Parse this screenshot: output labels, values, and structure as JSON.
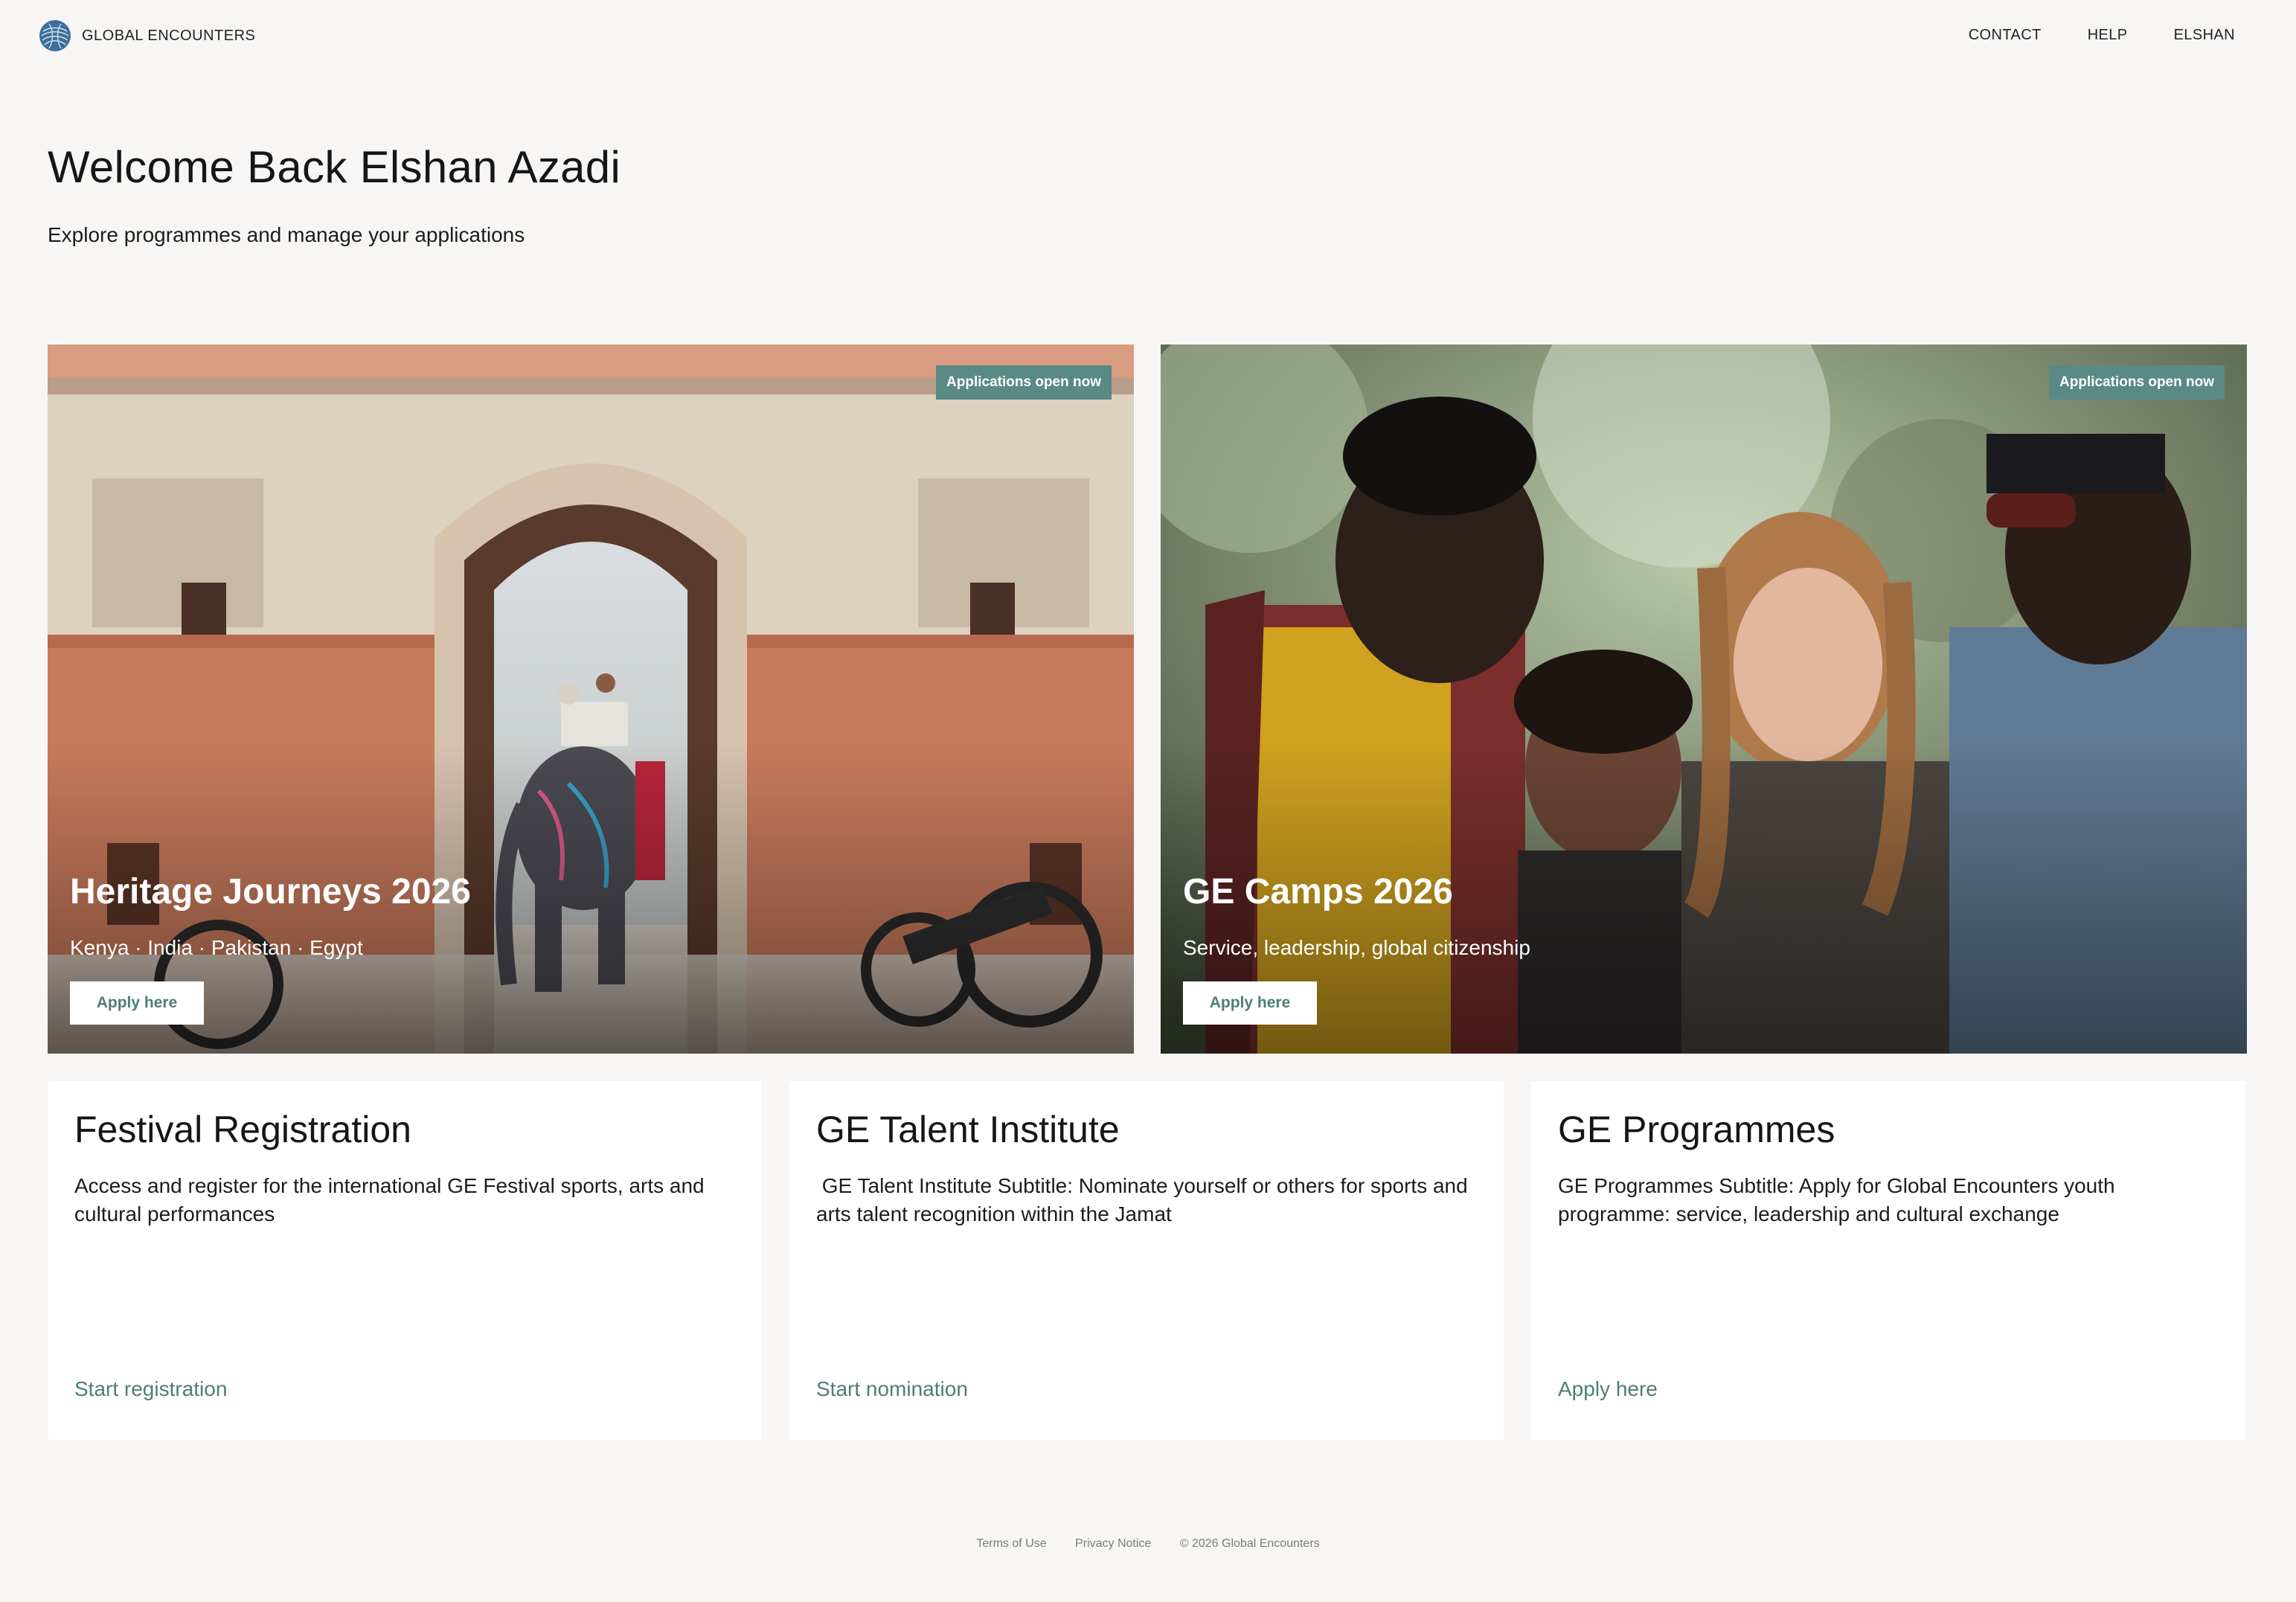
{
  "brand": {
    "name": "GLOBAL ENCOUNTERS",
    "logo_icon": "globe-fingerprint-icon"
  },
  "nav": {
    "contact": "CONTACT",
    "help": "HELP",
    "user": "ELSHAN"
  },
  "welcome": {
    "title": "Welcome Back Elshan Azadi",
    "subtitle": "Explore programmes and manage your applications"
  },
  "heroes": [
    {
      "badge": "Applications open now",
      "title": "Heritage Journeys 2026",
      "subtitle": "Kenya · India · Pakistan · Egypt",
      "button": "Apply here"
    },
    {
      "badge": "Applications open now",
      "title": "GE Camps 2026",
      "subtitle": "Service, leadership, global citizenship",
      "button": "Apply here"
    }
  ],
  "cards": [
    {
      "title": "Festival Registration",
      "description": "Access and register for the international GE Festival sports, arts and cultural performances",
      "link": "Start registration"
    },
    {
      "title": "GE Talent Institute",
      "description": " GE Talent Institute Subtitle: Nominate yourself or others for sports and arts talent recognition within the Jamat",
      "link": "Start nomination"
    },
    {
      "title": "GE Programmes",
      "description": "GE Programmes Subtitle: Apply for Global Encounters youth programme: service, leadership and cultural exchange",
      "link": "Apply here"
    }
  ],
  "footer": {
    "terms": "Terms of Use",
    "privacy": "Privacy Notice",
    "copyright": "© 2026 Global Encounters"
  },
  "colors": {
    "accent": "#5a8a85",
    "link": "#4f7d78",
    "background": "#f7f6f4"
  }
}
